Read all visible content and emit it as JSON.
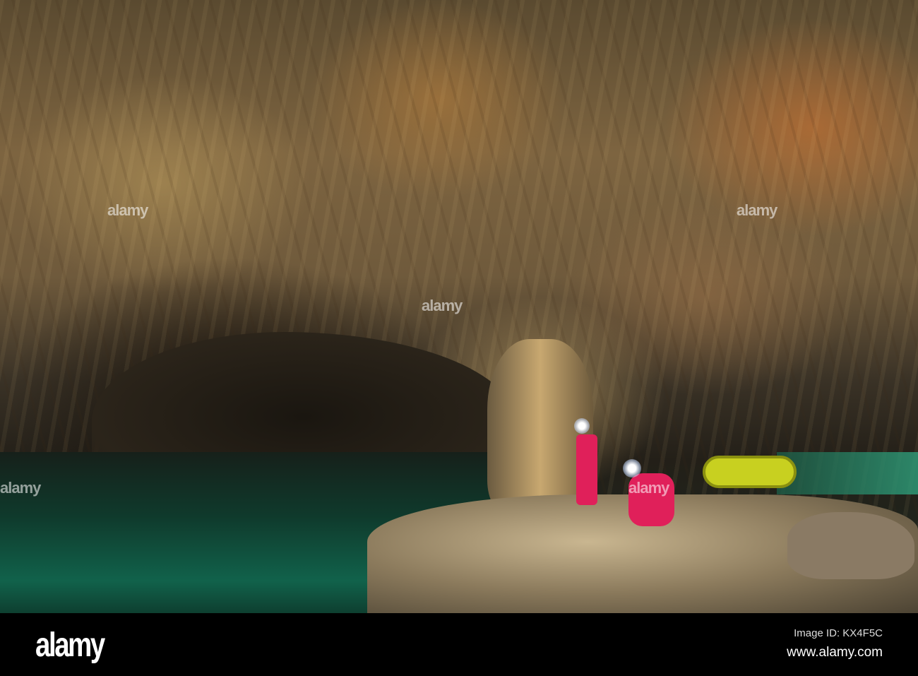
{
  "photo": {
    "subject": "cave"
  },
  "watermark": {
    "text": "alamy"
  },
  "footer": {
    "logo": "alamy",
    "image_id": "Image ID: KX4F5C",
    "site": "www.alamy.com"
  }
}
